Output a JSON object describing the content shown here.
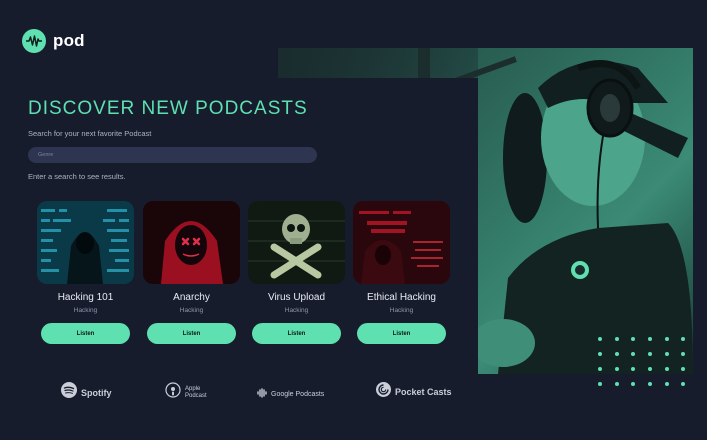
{
  "brand": {
    "name": "pod",
    "accent": "#5ee0b0"
  },
  "discover": {
    "headline": "DISCOVER NEW PODCASTS",
    "subtitle": "Search for your next favorite Podcast",
    "search_placeholder": "Genre",
    "hint": "Enter a search to see results."
  },
  "podcasts": [
    {
      "title": "Hacking 101",
      "category": "Hacking",
      "button": "Listen",
      "thumb_icon": "hooded-hacker-code-image"
    },
    {
      "title": "Anarchy",
      "category": "Hacking",
      "button": "Listen",
      "thumb_icon": "red-hoodie-mask-image"
    },
    {
      "title": "Virus Upload",
      "category": "Hacking",
      "button": "Listen",
      "thumb_icon": "skull-crossbones-image"
    },
    {
      "title": "Ethical Hacking",
      "category": "Hacking",
      "button": "Listen",
      "thumb_icon": "ethical-hacking-hooded-image"
    }
  ],
  "platforms": {
    "spotify": "Spotify",
    "apple_line1": "Apple",
    "apple_line2": "Podcast",
    "google": "Google Podcasts",
    "pocketcasts": "Pocket Casts"
  }
}
